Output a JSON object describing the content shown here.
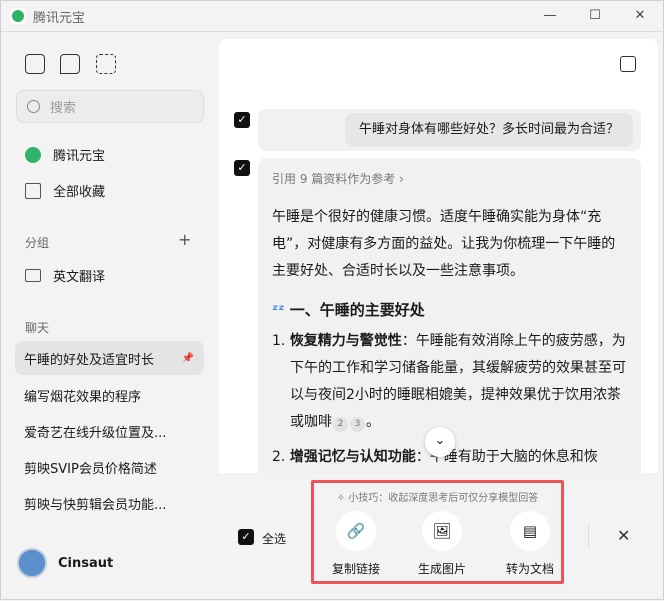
{
  "app": {
    "title": "腾讯元宝"
  },
  "sidebar": {
    "search_placeholder": "搜索",
    "nav": [
      {
        "label": "腾讯元宝"
      },
      {
        "label": "全部收藏"
      }
    ],
    "group_title": "分组",
    "groups": [
      {
        "label": "英文翻译"
      }
    ],
    "chats_title": "聊天",
    "chats": [
      {
        "label": "午睡的好处及适宜时长"
      },
      {
        "label": "编写烟花效果的程序"
      },
      {
        "label": "爱奇艺在线升级位置及..."
      },
      {
        "label": "剪映SVIP会员价格简述"
      },
      {
        "label": "剪映与快剪辑会员功能..."
      }
    ],
    "user": "Cinsaut"
  },
  "conversation": {
    "question": "午睡对身体有哪些好处？多长时间最为合适？",
    "ref": "引用 9 篇资料作为参考",
    "intro": "午睡是个很好的健康习惯。适度午睡确实能为身体“充电”，对健康有多方面的益处。让我为你梳理一下午睡的主要好处、合适时长以及一些注意事项。",
    "heading": "一、午睡的主要好处",
    "items": [
      {
        "num": "1.",
        "title": "恢复精力与警觉性",
        "body": "：午睡能有效消除上午的疲劳感，为下午的工作和学习储备能量，其缓解疲劳的效果甚至可以与夜间2小时的睡眠相媲美，提神效果优于饮用浓茶或咖啡",
        "cites": [
          "2",
          "3"
        ],
        "end": "。"
      },
      {
        "num": "2.",
        "title": "增强记忆与认知功能",
        "body": "：午睡有助于大脑的休息和恢"
      }
    ]
  },
  "share_bar": {
    "select_all": "全选",
    "tip": "小技巧：收起深度思考后可仅分享模型回答",
    "actions": [
      {
        "label": "复制链接"
      },
      {
        "label": "生成图片"
      },
      {
        "label": "转为文档"
      }
    ]
  },
  "colors": {
    "highlight": "#f0525a",
    "brand": "#2fb36b"
  }
}
